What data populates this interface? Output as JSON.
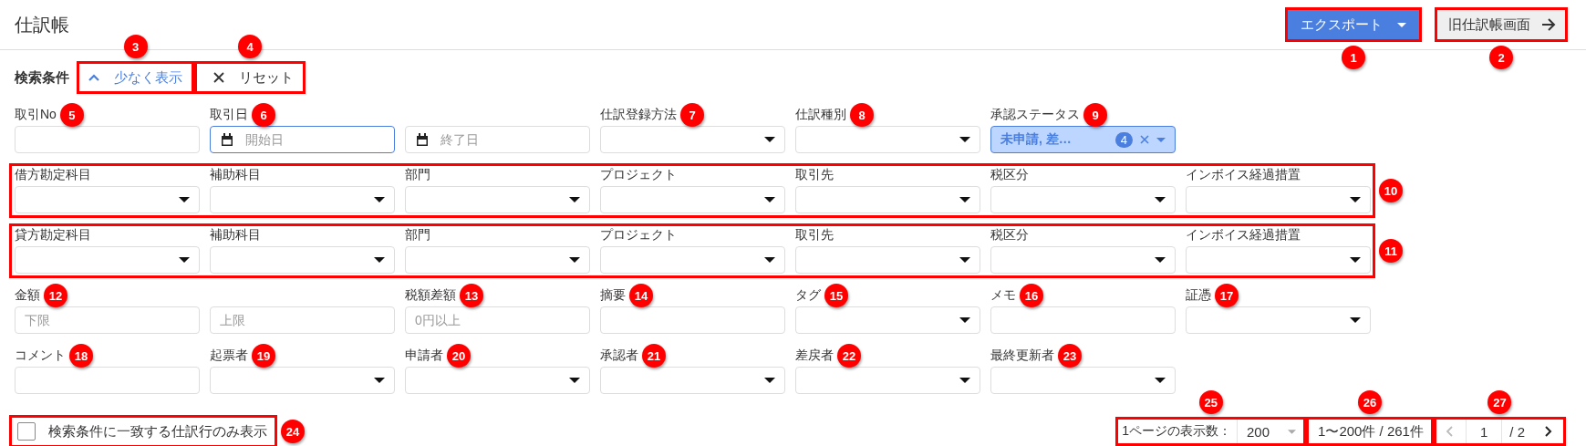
{
  "title": "仕訳帳",
  "export_button": {
    "label": "エクスポート",
    "marker": "1"
  },
  "old_screen_button": {
    "label": "旧仕訳帳画面",
    "marker": "2"
  },
  "search": {
    "heading": "検索条件",
    "less_button": {
      "label": "少なく表示",
      "marker": "3"
    },
    "reset_button": {
      "label": "リセット",
      "marker": "4"
    }
  },
  "field_rows": [
    {
      "fields": [
        {
          "kind": "text",
          "label": "取引No",
          "marker": "5"
        },
        {
          "kind": "date_range",
          "label": "取引日",
          "marker": "6",
          "inputs": [
            {
              "placeholder": "開始日",
              "focused": true
            },
            {
              "placeholder": "終了日",
              "focused": false
            }
          ]
        },
        {
          "kind": "select",
          "label": "仕訳登録方法",
          "marker": "7"
        },
        {
          "kind": "select",
          "label": "仕訳種別",
          "marker": "8"
        },
        {
          "kind": "chips",
          "label": "承認ステータス",
          "marker": "9",
          "value": "未申請, 差…",
          "count": "4"
        }
      ]
    },
    {
      "marker": "10",
      "fields": [
        {
          "kind": "select",
          "label": "借方勘定科目"
        },
        {
          "kind": "select",
          "label": "補助科目"
        },
        {
          "kind": "select",
          "label": "部門"
        },
        {
          "kind": "select",
          "label": "プロジェクト"
        },
        {
          "kind": "select",
          "label": "取引先"
        },
        {
          "kind": "select",
          "label": "税区分"
        },
        {
          "kind": "select",
          "label": "インボイス経過措置"
        }
      ]
    },
    {
      "marker": "11",
      "fields": [
        {
          "kind": "select",
          "label": "貸方勘定科目"
        },
        {
          "kind": "select",
          "label": "補助科目"
        },
        {
          "kind": "select",
          "label": "部門"
        },
        {
          "kind": "select",
          "label": "プロジェクト"
        },
        {
          "kind": "select",
          "label": "取引先"
        },
        {
          "kind": "select",
          "label": "税区分"
        },
        {
          "kind": "select",
          "label": "インボイス経過措置"
        }
      ]
    },
    {
      "fields": [
        {
          "kind": "range",
          "label": "金額",
          "marker": "12",
          "inputs": [
            {
              "placeholder": "下限"
            },
            {
              "placeholder": "上限"
            }
          ]
        },
        {
          "kind": "text",
          "label": "税額差額",
          "marker": "13",
          "placeholder": "0円以上"
        },
        {
          "kind": "text",
          "label": "摘要",
          "marker": "14"
        },
        {
          "kind": "select",
          "label": "タグ",
          "marker": "15"
        },
        {
          "kind": "text",
          "label": "メモ",
          "marker": "16"
        },
        {
          "kind": "select",
          "label": "証憑",
          "marker": "17"
        }
      ]
    },
    {
      "fields": [
        {
          "kind": "text",
          "label": "コメント",
          "marker": "18"
        },
        {
          "kind": "select",
          "label": "起票者",
          "marker": "19"
        },
        {
          "kind": "select",
          "label": "申請者",
          "marker": "20"
        },
        {
          "kind": "select",
          "label": "承認者",
          "marker": "21"
        },
        {
          "kind": "select",
          "label": "差戻者",
          "marker": "22"
        },
        {
          "kind": "select",
          "label": "最終更新者",
          "marker": "23"
        }
      ]
    }
  ],
  "only_matching": {
    "label": "検索条件に一致する仕訳行のみ表示",
    "checked": false,
    "marker": "24"
  },
  "per_page": {
    "label": "1ページの表示数：",
    "value": "200",
    "marker": "25"
  },
  "range": {
    "text": "1〜200件 / 261件",
    "marker": "26"
  },
  "pager": {
    "page": "1",
    "total": "/ 2",
    "prev_disabled": true,
    "next_disabled": false,
    "marker": "27"
  }
}
